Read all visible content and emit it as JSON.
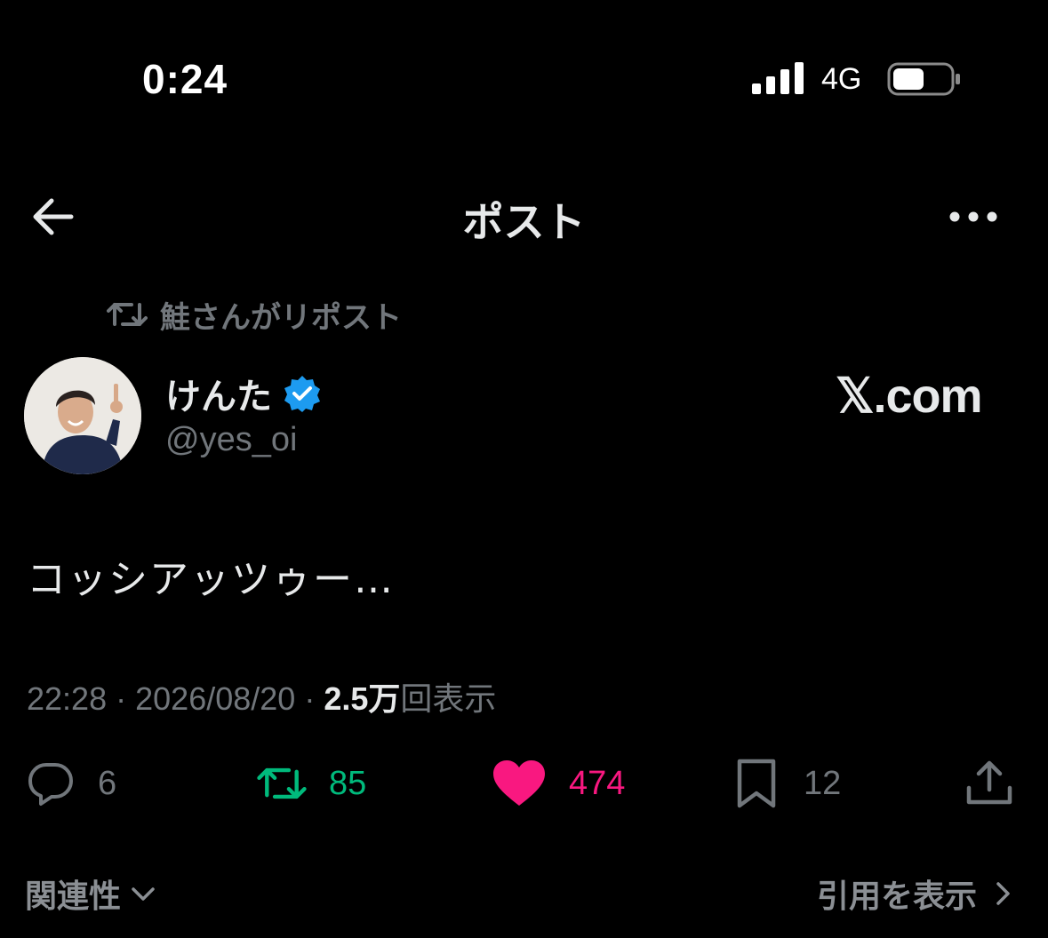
{
  "status_bar": {
    "time": "0:24",
    "network": "4G",
    "icons": [
      "signal-icon",
      "battery-icon"
    ]
  },
  "header": {
    "title": "ポスト",
    "back_icon": "back-arrow-icon",
    "more_icon": "more-icon"
  },
  "repost": {
    "text": "鮭さんがリポスト",
    "icon": "repost-icon"
  },
  "author": {
    "name": "けんた",
    "handle": "@yes_oi",
    "verified_icon": "verified-badge-icon"
  },
  "watermark": "𝕏.com",
  "tweet": {
    "text": "コッシアッツゥー…"
  },
  "meta": {
    "time": "22:28",
    "separator": "·",
    "date": "2026/08/20",
    "views_count": "2.5万",
    "views_label": "回表示"
  },
  "actions": {
    "reply_count": "6",
    "repost_count": "85",
    "like_count": "474",
    "bookmark_count": "12"
  },
  "bottom": {
    "sort_label": "関連性",
    "quotes_label": "引用を表示"
  },
  "colors": {
    "background": "#000000",
    "text": "#e7e9ea",
    "muted": "#71767b",
    "repost_green": "#00ba7c",
    "like_pink": "#f91880",
    "verified_blue": "#1d9bf0"
  }
}
